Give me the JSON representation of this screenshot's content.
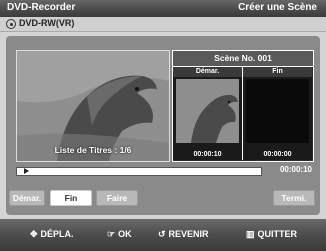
{
  "header": {
    "app_title": "DVD-Recorder",
    "screen_title": "Créer une Scène"
  },
  "disc": {
    "icon": "disc-icon",
    "label": "DVD-RW(VR)"
  },
  "preview": {
    "caption": "Liste de Titres : 1/6"
  },
  "scene": {
    "title": "Scène No. 001",
    "start": {
      "label": "Démar.",
      "time": "00:00:10"
    },
    "end": {
      "label": "Fin",
      "time": "00:00:00"
    }
  },
  "playback": {
    "current_time": "00:00:10",
    "progress_fraction": 0.03
  },
  "buttons": {
    "start": "Démar.",
    "end": "Fin",
    "make": "Faire",
    "finish": "Termi."
  },
  "navigation": [
    {
      "icon": "four-way-arrow-icon",
      "label": "DÉPLA."
    },
    {
      "icon": "ok-icon",
      "label": "OK"
    },
    {
      "icon": "return-icon",
      "label": "REVENIR"
    },
    {
      "icon": "menu-icon",
      "label": "QUITTER"
    }
  ],
  "colors": {
    "background": "#d4d4d4",
    "panel": "#8a8a8a",
    "title_bar": "#4a4a4a",
    "active_button": "#ffffff"
  }
}
